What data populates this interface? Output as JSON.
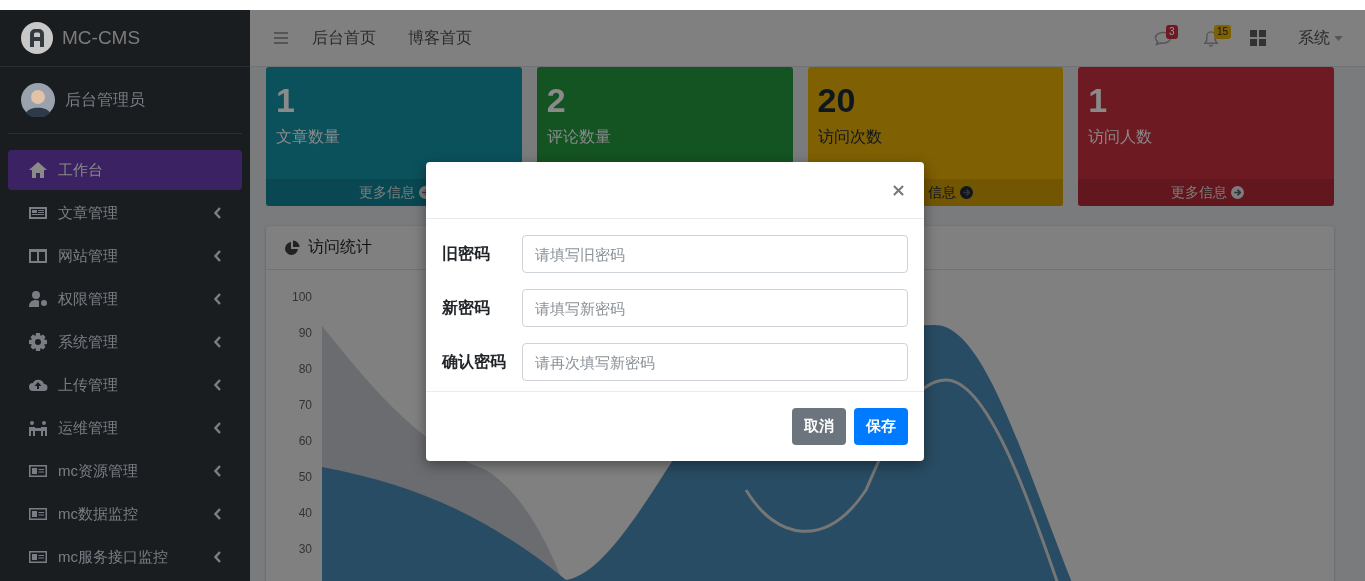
{
  "brand": {
    "name": "MC-CMS"
  },
  "user": {
    "name": "后台管理员"
  },
  "sidebar": {
    "items": [
      {
        "label": "工作台",
        "selected": true,
        "has_submenu": false
      },
      {
        "label": "文章管理",
        "selected": false,
        "has_submenu": true
      },
      {
        "label": "网站管理",
        "selected": false,
        "has_submenu": true
      },
      {
        "label": "权限管理",
        "selected": false,
        "has_submenu": true
      },
      {
        "label": "系统管理",
        "selected": false,
        "has_submenu": true
      },
      {
        "label": "上传管理",
        "selected": false,
        "has_submenu": true
      },
      {
        "label": "运维管理",
        "selected": false,
        "has_submenu": true
      },
      {
        "label": "mc资源管理",
        "selected": false,
        "has_submenu": true
      },
      {
        "label": "mc数据监控",
        "selected": false,
        "has_submenu": true
      },
      {
        "label": "mc服务接口监控",
        "selected": false,
        "has_submenu": true
      }
    ]
  },
  "topbar": {
    "links": [
      "后台首页",
      "博客首页"
    ],
    "messages_badge": "3",
    "notifications_badge": "15",
    "menu": "系统"
  },
  "cards": [
    {
      "value": "1",
      "label": "文章数量",
      "more": "更多信息",
      "color": "#0b515c",
      "dark_text": false
    },
    {
      "value": "2",
      "label": "评论数量",
      "color": "#145322",
      "dark_text": false
    },
    {
      "value": "20",
      "label": "访问次数",
      "more": "信息",
      "color": "#7f6003",
      "dark_text": true
    },
    {
      "value": "1",
      "label": "访问人数",
      "more": "更多信息",
      "color": "#6e1a22",
      "dark_text": false
    }
  ],
  "chart": {
    "title": "访问统计",
    "yticks": [
      "100",
      "90",
      "80",
      "70",
      "60",
      "50",
      "40",
      "30"
    ]
  },
  "modal": {
    "fields": [
      {
        "label": "旧密码",
        "placeholder": "请填写旧密码"
      },
      {
        "label": "新密码",
        "placeholder": "请填写新密码"
      },
      {
        "label": "确认密码",
        "placeholder": "请再次填写新密码"
      }
    ],
    "buttons": [
      {
        "label": "取消",
        "kind": "secondary"
      },
      {
        "label": "保存",
        "kind": "primary"
      }
    ]
  }
}
